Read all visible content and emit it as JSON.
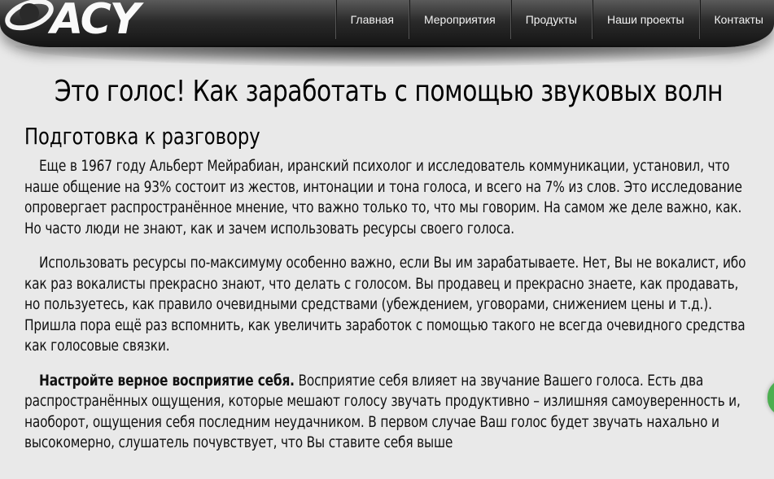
{
  "header": {
    "logo_text": "ACY",
    "logo_brand_color": "#ffffff"
  },
  "nav": {
    "items": [
      {
        "label": "Главная"
      },
      {
        "label": "Мероприятия"
      },
      {
        "label": "Продукты"
      },
      {
        "label": "Наши проекты"
      },
      {
        "label": "Контакты"
      }
    ]
  },
  "article": {
    "title": "Это голос! Как заработать с помощью звуковых волн",
    "section_heading": "Подготовка к разговору",
    "paragraphs": [
      "Еще в 1967 году Альберт Мейрабиан, иранский психолог и исследователь коммуникации, установил, что наше общение на 93% состоит из жестов, интонации и тона голоса, и всего на 7% из слов. Это исследование опровергает распространённое мнение, что важно только то, что мы говорим. На самом же деле важно, как. Но часто люди не знают, как и зачем использовать ресурсы своего голоса.",
      "Использовать ресурсы по-максимуму особенно важно, если Вы им зарабатываете. Нет, Вы не вокалист, ибо как раз вокалисты прекрасно знают, что делать с голосом. Вы продавец и прекрасно знаете, как продавать, но пользуетесь, как правило очевидными средствами (убеждением, уговорами, снижением цены и т.д.). Пришла пора ещё раз вспомнить, как увеличить заработок с помощью такого не всегда очевидного средства как голосовые связки."
    ],
    "third_paragraph": {
      "bold_lead": "Настройте верное восприятие себя.",
      "text": " Восприятие себя влияет на звучание Вашего голоса. Есть два распространённых ощущения, которые мешают голосу звучать продуктивно – излишняя самоуверенность и, наоборот, ощущения себя последним неудачником. В первом случае Ваш голос будет звучать нахально и высокомерно, слушатель почувствует, что Вы ставите себя выше"
    }
  },
  "colors": {
    "page_background": "#e9e9e9",
    "header_dark": "#141414",
    "side_badge": "#4caf50"
  }
}
